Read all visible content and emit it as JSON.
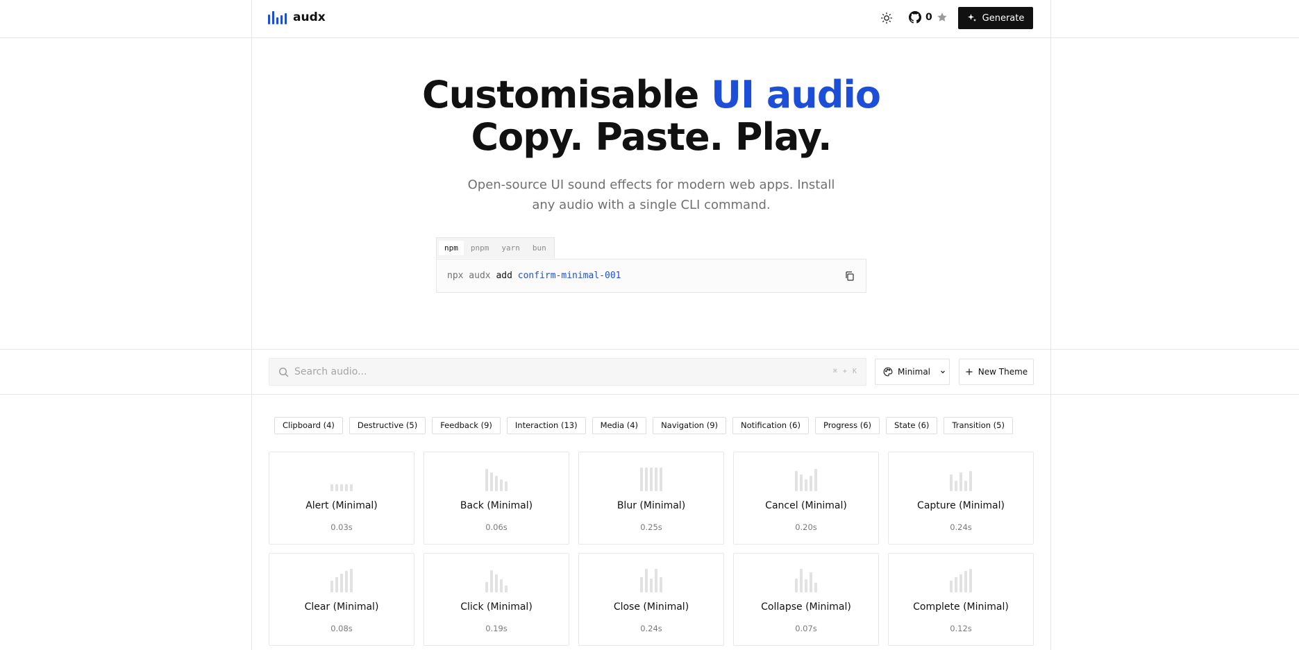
{
  "header": {
    "logo_text": "audx",
    "github_stars": "0",
    "generate_label": "Generate"
  },
  "hero": {
    "title_part1": "Customisable ",
    "title_accent": "UI audio",
    "title_line2": "Copy. Paste. Play.",
    "subtitle": "Open-source UI sound effects for modern web apps. Install any audio with a single CLI command."
  },
  "install": {
    "tabs": [
      "npm",
      "pnpm",
      "yarn",
      "bun"
    ],
    "active_tab": "npm",
    "cmd_runner": "npx audx",
    "cmd_verb": "add",
    "cmd_package": "confirm-minimal-001"
  },
  "toolbar": {
    "search_placeholder": "Search audio...",
    "shortcut": "⌘ + K",
    "theme_label": "Minimal",
    "new_theme_label": "New Theme"
  },
  "categories": [
    "Clipboard (4)",
    "Destructive (5)",
    "Feedback (9)",
    "Interaction (13)",
    "Media (4)",
    "Navigation (9)",
    "Notification (6)",
    "Progress (6)",
    "State (6)",
    "Transition (5)"
  ],
  "sounds": [
    {
      "name": "Alert (Minimal)",
      "duration": "0.03s",
      "wave": [
        0.3,
        0.3,
        0.3,
        0.3,
        0.3
      ]
    },
    {
      "name": "Back (Minimal)",
      "duration": "0.06s",
      "wave": [
        0.95,
        0.8,
        0.65,
        0.5,
        0.4
      ]
    },
    {
      "name": "Blur (Minimal)",
      "duration": "0.25s",
      "wave": [
        1,
        1,
        1,
        1,
        1
      ]
    },
    {
      "name": "Cancel (Minimal)",
      "duration": "0.20s",
      "wave": [
        0.85,
        0.7,
        0.5,
        0.65,
        0.95
      ]
    },
    {
      "name": "Capture (Minimal)",
      "duration": "0.24s",
      "wave": [
        0.7,
        0.45,
        0.8,
        0.45,
        0.85
      ]
    },
    {
      "name": "Clear (Minimal)",
      "duration": "0.08s",
      "wave": [
        0.5,
        0.65,
        0.8,
        0.9,
        1
      ]
    },
    {
      "name": "Click (Minimal)",
      "duration": "0.19s",
      "wave": [
        0.45,
        0.95,
        0.75,
        0.55,
        0.3
      ]
    },
    {
      "name": "Close (Minimal)",
      "duration": "0.24s",
      "wave": [
        0.65,
        1,
        0.6,
        1,
        0.65
      ]
    },
    {
      "name": "Collapse (Minimal)",
      "duration": "0.07s",
      "wave": [
        0.6,
        1,
        0.55,
        0.85,
        0.4
      ]
    },
    {
      "name": "Complete (Minimal)",
      "duration": "0.12s",
      "wave": [
        0.5,
        0.65,
        0.75,
        0.9,
        1
      ]
    }
  ]
}
